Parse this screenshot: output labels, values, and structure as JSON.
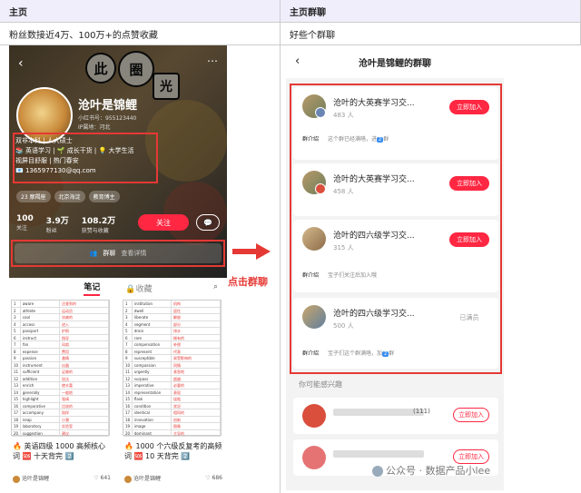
{
  "table": {
    "col1_header": "主页",
    "col2_header": "主页群聊",
    "col1_desc": "粉丝数接近4万、100万+的点赞收藏",
    "col2_desc": "好些个群聊"
  },
  "profile": {
    "cover_deco": [
      "此",
      "圈",
      "光"
    ],
    "name": "沧叶是锦鲤",
    "id_line": "小红书号：955123440",
    "ip_line": "IP属地：河北",
    "bio": [
      "双非本科 | 人大硕士",
      "📚 英语学习 | 🌱 成长干货 | 💡 大学生活",
      "视屏目舒服 | 热门春安",
      "📧 1365977130@qq.com"
    ],
    "tags": [
      "23 摩羯座",
      "北京海淀",
      "教育博主"
    ],
    "stats": [
      {
        "num": "100",
        "label": "关注"
      },
      {
        "num": "3.9万",
        "label": "粉丝"
      },
      {
        "num": "108.2万",
        "label": "获赞与收藏"
      }
    ],
    "follow_label": "关注",
    "chat_icon": "chat-bubble-icon",
    "group_label": "群聊",
    "group_sub": "查看详情",
    "tab_notes": "笔记",
    "tab_collect": "收藏",
    "search_icon": "search-icon"
  },
  "notes": [
    {
      "title": "🔥 英语四级 1000 高频核心词 🆘 十天背完 2️⃣",
      "author": "沧叶是锦鲤",
      "likes": "641",
      "rows": [
        [
          "1",
          "aware",
          "注意到的"
        ],
        [
          "2",
          "athlete",
          "运动员"
        ],
        [
          "3",
          "cool",
          "凉爽的"
        ],
        [
          "4",
          "access",
          "进入"
        ],
        [
          "5",
          "passport",
          "护照"
        ],
        [
          "6",
          "instruct",
          "指导"
        ],
        [
          "7",
          "fan",
          "风扇"
        ],
        [
          "8",
          "expense",
          "费用"
        ],
        [
          "9",
          "passion",
          "激情"
        ],
        [
          "10",
          "instrument",
          "仪器"
        ],
        [
          "11",
          "sufficient",
          "足够的"
        ],
        [
          "12",
          "addition",
          "加法"
        ],
        [
          "13",
          "enrich",
          "使丰富"
        ],
        [
          "14",
          "generally",
          "一般地"
        ],
        [
          "15",
          "highlight",
          "强调"
        ],
        [
          "16",
          "comparative",
          "比较的"
        ],
        [
          "17",
          "accompany",
          "陪伴"
        ],
        [
          "18",
          "neap",
          "小潮"
        ],
        [
          "19",
          "laboratory",
          "实验室"
        ],
        [
          "20",
          "suggestion",
          "建议"
        ]
      ]
    },
    {
      "title": "🔥 1000 个六级反复考的高频词 🆘 10 天背完 2️⃣",
      "author": "沧叶是锦鲤",
      "likes": "686",
      "rows": [
        [
          "1",
          "institution",
          "机构"
        ],
        [
          "2",
          "dwell",
          "居住"
        ],
        [
          "3",
          "liberate",
          "解放"
        ],
        [
          "4",
          "segment",
          "部分"
        ],
        [
          "5",
          "drain",
          "排水"
        ],
        [
          "6",
          "rare",
          "稀有的"
        ],
        [
          "7",
          "compensation",
          "补偿"
        ],
        [
          "8",
          "represent",
          "代表"
        ],
        [
          "9",
          "susceptible",
          "易受影响的"
        ],
        [
          "10",
          "compassion",
          "同情"
        ],
        [
          "11",
          "urgently",
          "紧急地"
        ],
        [
          "12",
          "surpass",
          "超越"
        ],
        [
          "13",
          "imperative",
          "必要的"
        ],
        [
          "14",
          "representation",
          "表现"
        ],
        [
          "15",
          "flask",
          "烧瓶"
        ],
        [
          "16",
          "condition",
          "状况"
        ],
        [
          "17",
          "identical",
          "相同的"
        ],
        [
          "18",
          "innovation",
          "创新"
        ],
        [
          "19",
          "image",
          "图像"
        ],
        [
          "20",
          "dominant",
          "主导的"
        ]
      ]
    }
  ],
  "annotation": {
    "label": "点击群聊",
    "arrow_color": "#e53935"
  },
  "groups_page": {
    "title": "沧叶是锦鲤的群聊",
    "back_icon": "back-arrow-icon",
    "intro_label": "群介绍",
    "groups": [
      {
        "name": "沧叶的大英赛学习交...",
        "count": "483 人",
        "button": "立即加入",
        "intro": "这个群已经满咯，进",
        "badge": "2",
        "intro_tail": "群"
      },
      {
        "name": "沧叶的大英赛学习交...",
        "count": "458 人",
        "button": "立即加入",
        "intro": "",
        "badge": "",
        "intro_tail": ""
      },
      {
        "name": "沧叶的四六级学习交...",
        "count": "315 人",
        "button": "立即加入",
        "intro": "宝子们关注后加入哦",
        "badge": "",
        "intro_tail": ""
      },
      {
        "name": "沧叶的四六级学习交...",
        "count": "500 人",
        "button": "已满员",
        "intro": "宝子们这个群满咯，加",
        "badge": "2",
        "intro_tail": "群"
      }
    ],
    "maybe_label": "你可能感兴趣",
    "suggestions": [
      {
        "count": "(111)",
        "button": "立即加入"
      },
      {
        "count": "",
        "button": "立即加入"
      }
    ]
  },
  "watermark": "公众号 · 数据产品小lee",
  "colors": {
    "accent": "#ff2742",
    "highlight": "#e53935",
    "header_bg": "#f1eefc"
  }
}
